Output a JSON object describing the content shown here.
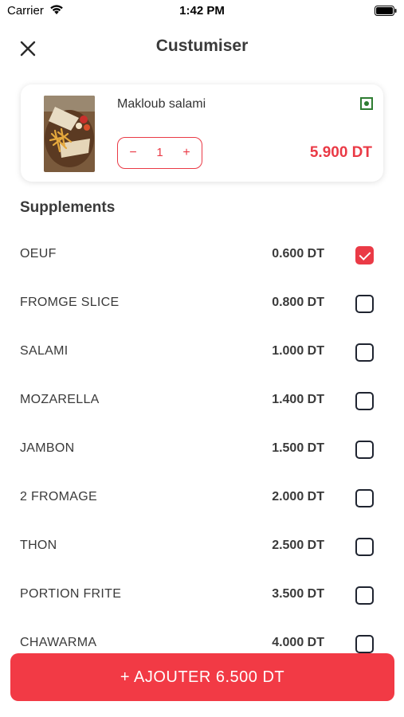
{
  "status_bar": {
    "carrier": "Carrier",
    "time": "1:42 PM"
  },
  "header": {
    "title": "Custumiser",
    "close_icon": "close-icon"
  },
  "product": {
    "name": "Makloub salami",
    "quantity": "1",
    "minus_label": "−",
    "plus_label": "+",
    "price": "5.900 DT",
    "image_icon": "food-photo",
    "indicator_color": "#2e7d32"
  },
  "supplements": {
    "title": "Supplements",
    "items": [
      {
        "name": "OEUF",
        "price": "0.600 DT",
        "checked": true
      },
      {
        "name": "FROMGE SLICE",
        "price": "0.800 DT",
        "checked": false
      },
      {
        "name": "SALAMI",
        "price": "1.000 DT",
        "checked": false
      },
      {
        "name": "MOZARELLA",
        "price": "1.400 DT",
        "checked": false
      },
      {
        "name": "JAMBON",
        "price": "1.500 DT",
        "checked": false
      },
      {
        "name": "2 FROMAGE",
        "price": "2.000 DT",
        "checked": false
      },
      {
        "name": "THON",
        "price": "2.500 DT",
        "checked": false
      },
      {
        "name": "PORTION FRITE",
        "price": "3.500 DT",
        "checked": false
      },
      {
        "name": "CHAWARMA",
        "price": "4.000 DT",
        "checked": false
      }
    ]
  },
  "add_button": {
    "label": "+ AJOUTER 6.500 DT"
  },
  "colors": {
    "accent": "#ea3a46",
    "button": "#f23a45",
    "text": "#3a3a3a"
  }
}
